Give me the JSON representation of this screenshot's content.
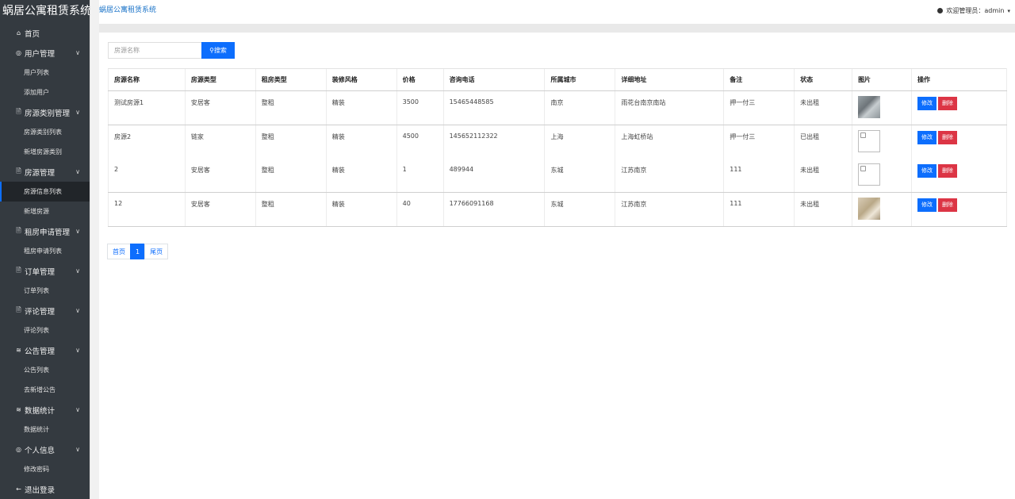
{
  "app": {
    "brand": "蜗居公寓租赁系统"
  },
  "header": {
    "breadcrumb": "蜗居公寓租赁系统",
    "user_label": "欢迎管理员：admin"
  },
  "sidebar": {
    "home": {
      "icon": "home-icon",
      "label": "首页"
    },
    "groups": [
      {
        "icon": "user-circle-icon",
        "label": "用户管理",
        "items": [
          "用户列表",
          "添加用户"
        ]
      },
      {
        "icon": "document-icon",
        "label": "房源类别管理",
        "items": [
          "房源类别列表",
          "新增房源类别"
        ]
      },
      {
        "icon": "document-icon",
        "label": "房源管理",
        "items": [
          "房源信息列表",
          "新增房源"
        ]
      },
      {
        "icon": "document-icon",
        "label": "租房申请管理",
        "items": [
          "租房申请列表"
        ]
      },
      {
        "icon": "document-icon",
        "label": "订单管理",
        "items": [
          "订单列表"
        ]
      },
      {
        "icon": "document-icon",
        "label": "评论管理",
        "items": [
          "评论列表"
        ]
      },
      {
        "icon": "layers-icon",
        "label": "公告管理",
        "items": [
          "公告列表",
          "去新增公告"
        ]
      },
      {
        "icon": "layers-icon",
        "label": "数据统计",
        "items": [
          "数据统计"
        ]
      },
      {
        "icon": "user-circle-icon",
        "label": "个人信息",
        "items": [
          "修改密码"
        ]
      }
    ],
    "logout": {
      "icon": "arrow-left-icon",
      "label": "退出登录"
    },
    "active_item": "房源信息列表"
  },
  "search": {
    "placeholder": "房源名称",
    "button_label": "搜索",
    "button_icon": "search-icon"
  },
  "table": {
    "columns": [
      "房源名称",
      "房源类型",
      "租房类型",
      "装修风格",
      "价格",
      "咨询电话",
      "所属城市",
      "详细地址",
      "备注",
      "状态",
      "图片",
      "操作"
    ],
    "rows": [
      {
        "name": "测试房源1",
        "type": "安居客",
        "rent": "整租",
        "style": "精装",
        "price": "3500",
        "phone": "15465448585",
        "city": "南京",
        "address": "雨花台南京南站",
        "note": "押一付三",
        "status": "未出租",
        "image": "photo"
      },
      {
        "name": "房源2",
        "type": "链家",
        "rent": "整租",
        "style": "精装",
        "price": "4500",
        "phone": "145652112322",
        "city": "上海",
        "address": "上海虹桥站",
        "note": "押一付三",
        "status": "已出租",
        "image": "broken"
      },
      {
        "name": "2",
        "type": "安居客",
        "rent": "整租",
        "style": "精装",
        "price": "1",
        "phone": "489944",
        "city": "东城",
        "address": "江苏南京",
        "note": "111",
        "status": "未出租",
        "image": "broken"
      },
      {
        "name": "12",
        "type": "安居客",
        "rent": "整租",
        "style": "精装",
        "price": "40",
        "phone": "17766091168",
        "city": "东城",
        "address": "江苏南京",
        "note": "111",
        "status": "未出租",
        "image": "photo"
      }
    ],
    "actions": {
      "edit": "修改",
      "delete": "删除"
    }
  },
  "pagination": {
    "first": "首页",
    "current": "1",
    "last": "尾页"
  },
  "colors": {
    "sidebar_bg": "#343a40",
    "primary": "#0d6efd",
    "danger": "#dc3545"
  }
}
